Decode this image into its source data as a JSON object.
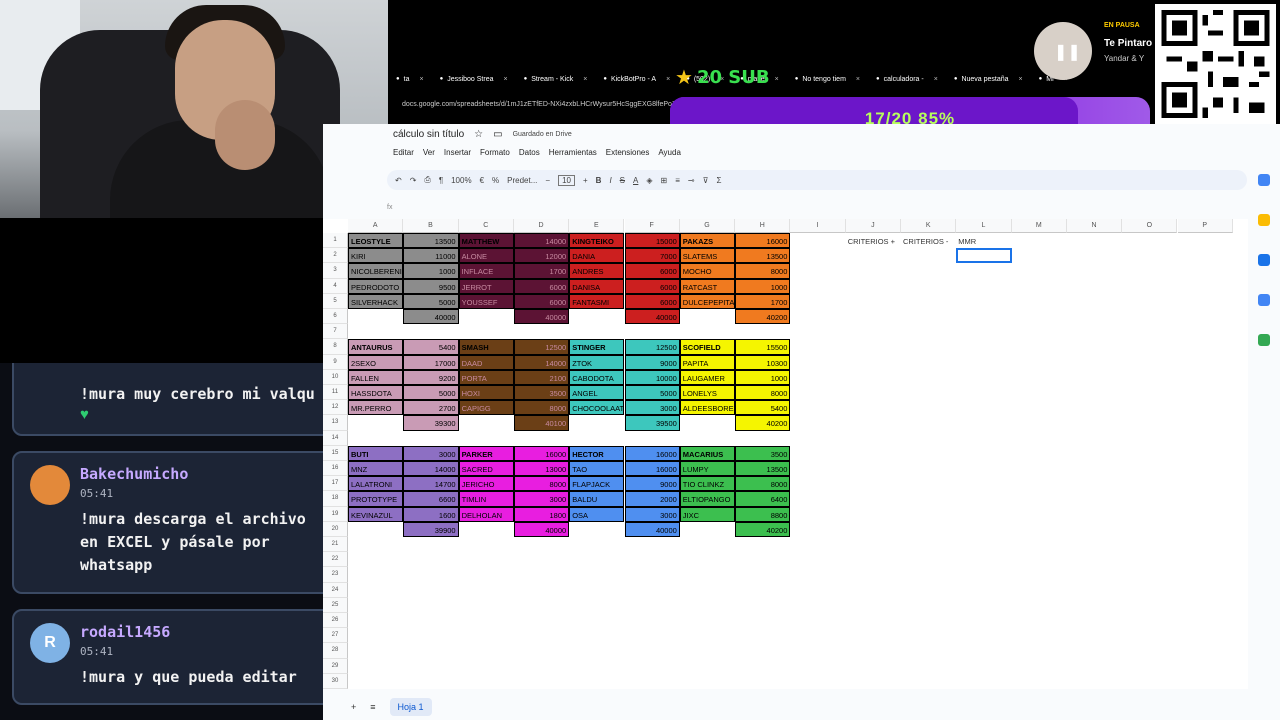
{
  "browser": {
    "tabs": [
      {
        "label": "ta",
        "icon": "tab-icon"
      },
      {
        "label": "Jessiboo Strea",
        "icon": "kick-icon"
      },
      {
        "label": "Stream - Kick",
        "icon": "kick-icon"
      },
      {
        "label": "KickBotPro - A",
        "icon": "bot-icon"
      },
      {
        "label": "(502)",
        "icon": "youtube-icon"
      },
      {
        "label": "playe",
        "icon": "tab-icon"
      },
      {
        "label": "No tengo tiem",
        "icon": "tiktok-icon"
      },
      {
        "label": "calculadora -",
        "icon": "google-icon"
      },
      {
        "label": "Nueva pestaña",
        "icon": "chrome-icon"
      },
      {
        "label": "Mi",
        "icon": "tab-icon"
      }
    ],
    "url": "docs.google.com/spreadsheets/d/1mJ1zETfED-NXi4zxbLHCrWysur5HcSggEXG8lfePo7M"
  },
  "overlay": {
    "sub_goal": "20 SUB",
    "progress": "17/20 85%",
    "progress_fraction": 0.85,
    "music_status": "EN PAUSA",
    "music_title": "Te Pintaro",
    "music_artist": "Yandar & Y"
  },
  "chat": {
    "messages": [
      {
        "user": "",
        "time": "",
        "text": "!mura muy cerebro mi valqu",
        "heart": "♥"
      },
      {
        "user": "Bakechumicho",
        "time": "05:41",
        "text": "!mura descarga el archivo en EXCEL y pásale por whatsapp",
        "avatar_color": "#e3893a"
      },
      {
        "user": "rodail1456",
        "time": "05:41",
        "text": "!mura y que pueda editar",
        "avatar_color": "#7fb2e5",
        "initial": "R"
      }
    ]
  },
  "sheets": {
    "title": "cálculo sin título",
    "saved": "Guardado en Drive",
    "menu": [
      "Editar",
      "Ver",
      "Insertar",
      "Formato",
      "Datos",
      "Herramientas",
      "Extensiones",
      "Ayuda"
    ],
    "zoom": "100%",
    "currency": "€",
    "percent": "%",
    "font": "Predet...",
    "font_size": "10",
    "formula_label": "fx",
    "columns": [
      "A",
      "B",
      "C",
      "D",
      "E",
      "F",
      "G",
      "H",
      "I",
      "J",
      "K",
      "L",
      "M",
      "N",
      "O",
      "P"
    ],
    "criteria": {
      "J1": "CRITERIOS +",
      "K1": "CRITERIOS -",
      "L1": "MMR"
    },
    "sheet_tab": "Hoja 1",
    "teams": [
      {
        "color": "#8c8c8c",
        "name_color": "#000",
        "col": 0,
        "row": 0,
        "total": "40000",
        "players": [
          [
            "LEOSTYLE",
            "13500"
          ],
          [
            "KIRI",
            "11000"
          ],
          [
            "NICOLBERENIC",
            "1000"
          ],
          [
            "PEDRODOTO",
            "9500"
          ],
          [
            "SILVERHACK",
            "5000"
          ]
        ]
      },
      {
        "color": "#5c1334",
        "col": 2,
        "row": 0,
        "total": "40000",
        "players": [
          [
            "MATTHEW",
            "14000"
          ],
          [
            "ALONE",
            "12000"
          ],
          [
            "INFLACE",
            "1700"
          ],
          [
            "JERROT",
            "6000"
          ],
          [
            "YOUSSEF",
            "6000"
          ]
        ]
      },
      {
        "color": "#cc1f1f",
        "col": 4,
        "row": 0,
        "total": "40000",
        "players": [
          [
            "KINGTEIKO",
            "15000"
          ],
          [
            "DANIA",
            "7000"
          ],
          [
            "ANDRES",
            "6000"
          ],
          [
            "DANISA",
            "6000"
          ],
          [
            "FANTASMI",
            "6000"
          ]
        ]
      },
      {
        "color": "#f07a1f",
        "col": 6,
        "row": 0,
        "total": "40200",
        "players": [
          [
            "PAKAZS",
            "16000"
          ],
          [
            "SLATEMS",
            "13500"
          ],
          [
            "MOCHO",
            "8000"
          ],
          [
            "RATCAST",
            "1000"
          ],
          [
            "DULCEPEPITA",
            "1700"
          ]
        ]
      },
      {
        "color": "#c99bb5",
        "col": 0,
        "row": 7,
        "total": "39300",
        "players": [
          [
            "ANTAURUS",
            "5400"
          ],
          [
            "2SEXO",
            "17000"
          ],
          [
            "FALLEN",
            "9200"
          ],
          [
            "HASSDOTA",
            "5000"
          ],
          [
            "MR.PERRO",
            "2700"
          ]
        ]
      },
      {
        "color": "#6b3f16",
        "col": 2,
        "row": 7,
        "total": "40100",
        "players": [
          [
            "SMASH",
            "12500"
          ],
          [
            "DAAD",
            "14000"
          ],
          [
            "PORTA",
            "2100"
          ],
          [
            "HOXI",
            "3500"
          ],
          [
            "CAPIGG",
            "8000"
          ]
        ]
      },
      {
        "color": "#3dc7bd",
        "col": 4,
        "row": 7,
        "total": "39500",
        "players": [
          [
            "STINGER",
            "12500"
          ],
          [
            "ZTOK",
            "9000"
          ],
          [
            "CABODOTA",
            "10000"
          ],
          [
            "ANGEL",
            "5000"
          ],
          [
            "CHOCOOLAATE",
            "3000"
          ]
        ]
      },
      {
        "color": "#f5f500",
        "col": 6,
        "row": 7,
        "total": "40200",
        "players": [
          [
            "SCOFIELD",
            "15500"
          ],
          [
            "PAPITA",
            "10300"
          ],
          [
            "LAUGAMER",
            "1000"
          ],
          [
            "LONELYS",
            "8000"
          ],
          [
            "ALDEESBORED",
            "5400"
          ]
        ]
      },
      {
        "color": "#8d6fc3",
        "col": 0,
        "row": 14,
        "total": "39900",
        "players": [
          [
            "BUTI",
            "3000"
          ],
          [
            "MNZ",
            "14000"
          ],
          [
            "LALATRONI",
            "14700"
          ],
          [
            "PROTOTYPE",
            "6600"
          ],
          [
            "KEVINAZUL",
            "1600"
          ]
        ]
      },
      {
        "color": "#e81ee0",
        "col": 2,
        "row": 14,
        "total": "40000",
        "players": [
          [
            "PARKER",
            "16000"
          ],
          [
            "SACRED",
            "13000"
          ],
          [
            "JERICHO",
            "8000"
          ],
          [
            "TIMLIN",
            "3000"
          ],
          [
            "DELHOLAN",
            "1800"
          ]
        ]
      },
      {
        "color": "#4f8ff0",
        "col": 4,
        "row": 14,
        "total": "40000",
        "players": [
          [
            "HECTOR",
            "16000"
          ],
          [
            "TAO",
            "16000"
          ],
          [
            "FLAPJACK",
            "9000"
          ],
          [
            "BALDU",
            "2000"
          ],
          [
            "OSA",
            "3000"
          ]
        ]
      },
      {
        "color": "#3cbf4f",
        "col": 6,
        "row": 14,
        "total": "40200",
        "players": [
          [
            "MACARIUS",
            "3500"
          ],
          [
            "LUMPY",
            "13500"
          ],
          [
            "TIO CLINKZ",
            "8000"
          ],
          [
            "ELTIOPANGO",
            "6400"
          ],
          [
            "JIXC",
            "8800"
          ]
        ]
      }
    ]
  }
}
